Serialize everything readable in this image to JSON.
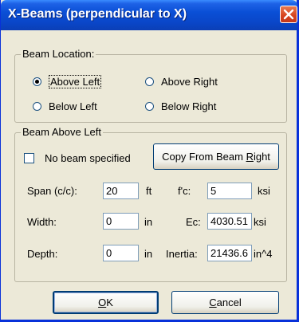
{
  "window": {
    "title": "X-Beams (perpendicular to X)"
  },
  "beam_location": {
    "label": "Beam Location:",
    "options": [
      {
        "label": "Above Left",
        "checked": true
      },
      {
        "label": "Above Right",
        "checked": false
      },
      {
        "label": "Below Left",
        "checked": false
      },
      {
        "label": "Below Right",
        "checked": false
      }
    ]
  },
  "beam": {
    "group_label": "Beam Above Left",
    "no_beam_label": "No beam specified",
    "copy_button": {
      "prefix": "Copy From Beam ",
      "mnemonic": "R",
      "suffix": "ight"
    },
    "span": {
      "label": "Span (c/c):",
      "value": "20",
      "unit": "ft"
    },
    "width": {
      "label": "Width:",
      "value": "0",
      "unit": "in"
    },
    "depth": {
      "label": "Depth:",
      "value": "0",
      "unit": "in"
    },
    "fc": {
      "label": "f'c:",
      "value": "5",
      "unit": "ksi"
    },
    "ec": {
      "label": "Ec:",
      "value": "4030.51",
      "unit": "ksi"
    },
    "inertia": {
      "label": "Inertia:",
      "value": "21436.6",
      "unit": "in^4"
    }
  },
  "buttons": {
    "ok": {
      "mnemonic": "O",
      "rest": "K"
    },
    "cancel": {
      "mnemonic": "C",
      "rest": "ancel"
    }
  }
}
